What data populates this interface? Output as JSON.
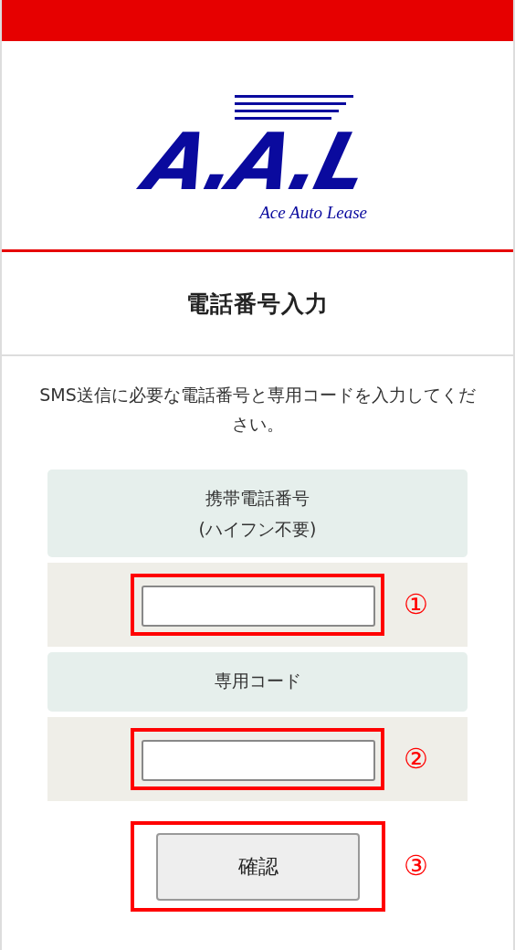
{
  "logo": {
    "mark": "A.A.L",
    "tagline": "Ace Auto Lease"
  },
  "page_title": "電話番号入力",
  "instructions": "SMS送信に必要な電話番号と専用コードを入力してください。",
  "fields": [
    {
      "label_lines": [
        "携帯電話番号",
        "(ハイフン不要)"
      ],
      "annotation": "①"
    },
    {
      "label_lines": [
        "専用コード"
      ],
      "annotation": "②"
    }
  ],
  "submit": {
    "label": "確認",
    "annotation": "③"
  }
}
